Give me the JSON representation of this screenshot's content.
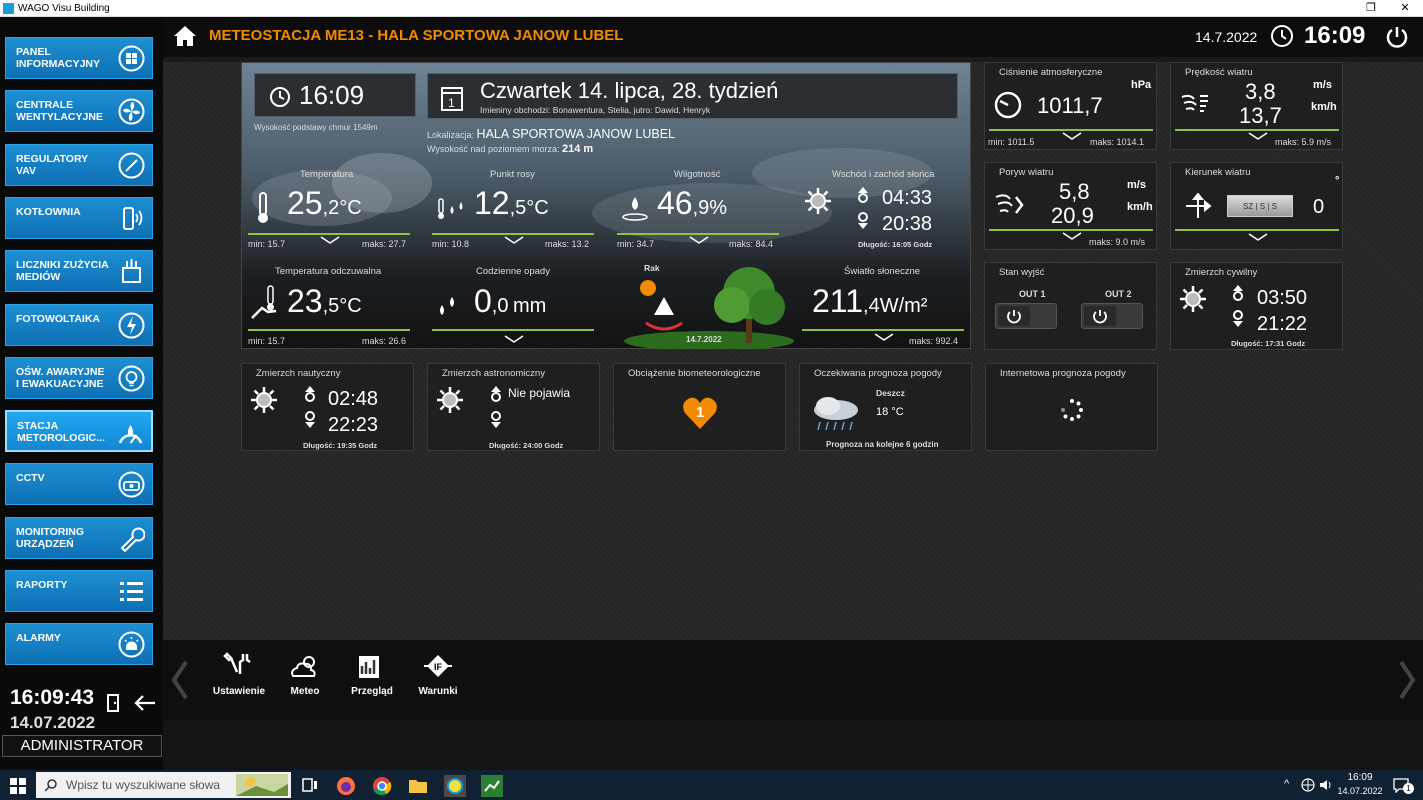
{
  "window": {
    "title": "WAGO Visu Building"
  },
  "sidebar": {
    "items": [
      {
        "label": "PANEL\nINFORMACYJNY",
        "icon": "grid-icon"
      },
      {
        "label": "CENTRALE\nWENTYLACYJNE",
        "icon": "fan-icon"
      },
      {
        "label": "REGULATORY\nVAV",
        "icon": "gauge-icon"
      },
      {
        "label": "KOTŁOWNIA",
        "icon": "boiler-icon"
      },
      {
        "label": "LICZNIKI ZUŻYCIA\nMEDIÓW",
        "icon": "meter-icon"
      },
      {
        "label": "FOTOWOLTAIKA",
        "icon": "lightning-icon"
      },
      {
        "label": "OŚW. AWARYJNE\nI EWAKUACYJNE",
        "icon": "bulb-icon"
      },
      {
        "label": "STACJA\nMETOROLOGIC...",
        "icon": "weather-station-icon"
      },
      {
        "label": "CCTV",
        "icon": "camera-icon"
      },
      {
        "label": "MONITORING\nURZĄDZEŃ",
        "icon": "wrench-icon"
      },
      {
        "label": "RAPORTY",
        "icon": "list-icon"
      },
      {
        "label": "ALARMY",
        "icon": "alarm-icon"
      }
    ],
    "active_index": 7,
    "clock": "16:09:43",
    "date": "14.07.2022",
    "user": "ADMINISTRATOR"
  },
  "header": {
    "title": "METEOSTACJA ME13 - HALA SPORTOWA JANOW LUBEL",
    "date": "14.7.2022",
    "time": "16:09"
  },
  "weather": {
    "time": "16:09",
    "cloud_base": "Wysokość podstawy chmur 1549m",
    "day_title": "Czwartek 14. lipca, 28. tydzień",
    "namedays": "Imieniny obchodzi: Bonawentura, Stelia, jutro: Dawid, Henryk",
    "location_label": "Lokalizacja:",
    "location": "HALA SPORTOWA JANOW LUBEL",
    "altitude_label": "Wysokość nad poziomem morza:",
    "altitude": "214 m",
    "temperature": {
      "title": "Temperatura",
      "int": "25",
      "dec": ",2",
      "unit": "°C",
      "min": "min: 15.7",
      "max": "maks: 27.7"
    },
    "dewpoint": {
      "title": "Punkt rosy",
      "int": "12",
      "dec": ",5",
      "unit": "°C",
      "min": "min: 10.8",
      "max": "maks: 13.2"
    },
    "humidity": {
      "title": "Wilgotność",
      "int": "46",
      "dec": ",9",
      "unit": "%",
      "min": "min: 34.7",
      "max": "maks: 84.4"
    },
    "sun": {
      "title": "Wschód i zachód słońca",
      "rise": "04:33",
      "set": "20:38",
      "length": "Długość: 16:05 Godz"
    },
    "feels": {
      "title": "Temperatura odczuwalna",
      "int": "23",
      "dec": ",5",
      "unit": "°C",
      "min": "min: 15.7",
      "max": "maks: 26.6"
    },
    "rain": {
      "title": "Codzienne opady",
      "int": "0",
      "dec": ",0",
      "unit": "mm"
    },
    "zodiac": {
      "name": "Rak",
      "date": "14.7.2022"
    },
    "sunlight": {
      "title": "Światło słoneczne",
      "int": "211",
      "dec": ",4",
      "unit": "W/m²",
      "max": "maks: 992.4"
    }
  },
  "pressure": {
    "title": "Ciśnienie atmosferyczne",
    "unit": "hPa",
    "value": "1011,7",
    "min": "min: 1011.5",
    "max": "maks: 1014.1"
  },
  "wind_speed": {
    "title": "Prędkość wiatru",
    "v1": "3,8",
    "u1": "m/s",
    "v2": "13,7",
    "u2": "km/h",
    "max": "maks: 5.9 m/s"
  },
  "gust": {
    "title": "Poryw wiatru",
    "v1": "5,8",
    "u1": "m/s",
    "v2": "20,9",
    "u2": "km/h",
    "max": "maks: 9.0 m/s"
  },
  "wind_dir": {
    "title": "Kierunek wiatru",
    "value": "0",
    "unit": "°",
    "compass": "SZ | S | S"
  },
  "outputs": {
    "title": "Stan wyjść",
    "out1": "OUT 1",
    "out2": "OUT 2"
  },
  "civil": {
    "title": "Zmierzch cywilny",
    "rise": "03:50",
    "set": "21:22",
    "length": "Długość: 17:31 Godz"
  },
  "nautical": {
    "title": "Zmierzch nautyczny",
    "rise": "02:48",
    "set": "22:23",
    "length": "Długość: 19:35 Godz"
  },
  "astro": {
    "title": "Zmierzch astronomiczny",
    "rise": "Nie pojawia",
    "length": "Długość: 24:00 Godz"
  },
  "bio": {
    "title": "Obciążenie biometeorologiczne",
    "value": "1"
  },
  "forecast": {
    "title": "Oczekiwana prognoza pogody",
    "cond": "Deszcz",
    "temp": "18 °C",
    "note": "Prognoza na kolejne 6 godzin"
  },
  "internet": {
    "title": "Internetowa prognoza pogody"
  },
  "tools": [
    {
      "label": "Ustawienie",
      "icon": "tools-icon"
    },
    {
      "label": "Meteo",
      "icon": "cloud-sun-icon"
    },
    {
      "label": "Przegląd",
      "icon": "overview-icon"
    },
    {
      "label": "Warunki",
      "icon": "conditions-icon"
    }
  ],
  "taskbar": {
    "search_placeholder": "Wpisz tu wyszukiwane słowa",
    "time": "16:09",
    "date": "14.07.2022",
    "notif": "1"
  }
}
